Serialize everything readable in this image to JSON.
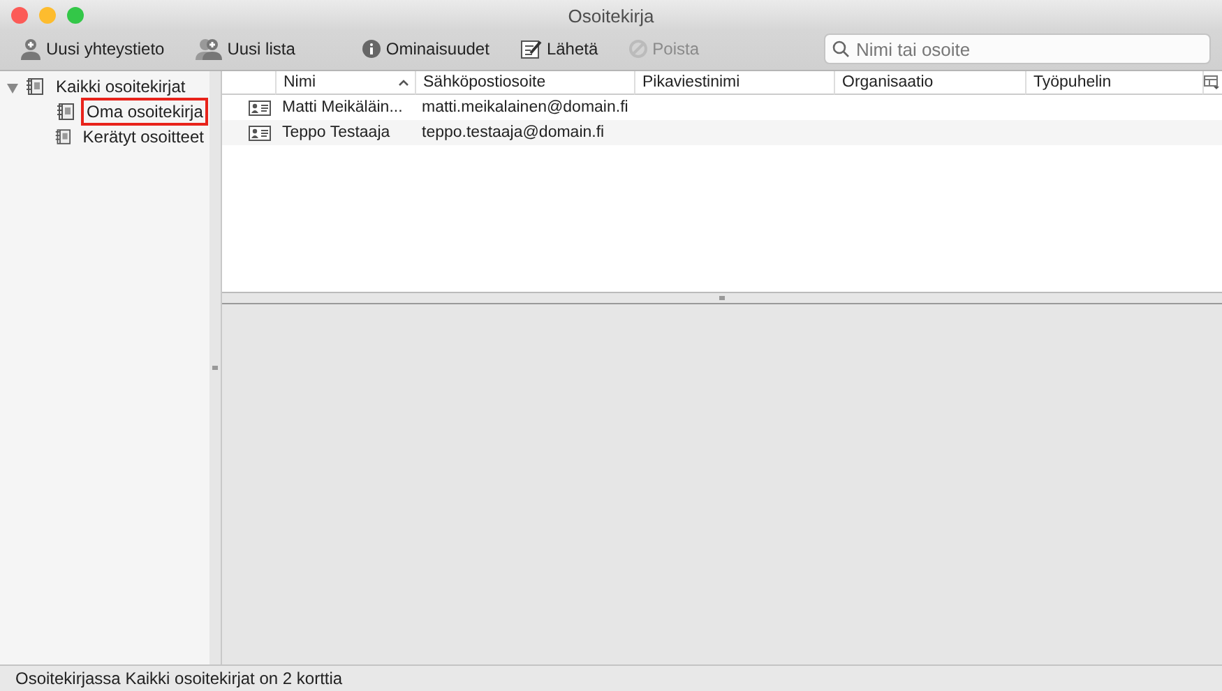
{
  "window": {
    "title": "Osoitekirja"
  },
  "toolbar": {
    "buttons": [
      {
        "label": "Uusi yhteystieto",
        "kind": "contact",
        "disabled": false
      },
      {
        "label": "Uusi lista",
        "kind": "list",
        "disabled": false
      },
      {
        "label": "Ominaisuudet",
        "kind": "info",
        "disabled": false
      },
      {
        "label": "Lähetä",
        "kind": "compose",
        "disabled": false
      },
      {
        "label": "Poista",
        "kind": "delete",
        "disabled": true
      }
    ],
    "search": {
      "placeholder": "Nimi tai osoite"
    }
  },
  "sidebar": {
    "items": [
      {
        "label": "Kaikki osoitekirjat",
        "expanded": true,
        "highlighted": false,
        "children": [
          {
            "label": "Oma osoitekirja",
            "highlighted": true
          },
          {
            "label": "Kerätyt osoitteet",
            "highlighted": false
          }
        ]
      }
    ]
  },
  "table": {
    "columns": [
      {
        "label": "Nimi",
        "sorted": true
      },
      {
        "label": "Sähköpostiosoite",
        "sorted": false
      },
      {
        "label": "Pikaviestinimi",
        "sorted": false
      },
      {
        "label": "Organisaatio",
        "sorted": false
      },
      {
        "label": "Työpuhelin",
        "sorted": false
      }
    ],
    "rows": [
      {
        "cells": [
          "Matti Meikäläin...",
          "matti.meikalainen@domain.fi",
          "",
          "",
          ""
        ]
      },
      {
        "cells": [
          "Teppo Testaaja",
          "teppo.testaaja@domain.fi",
          "",
          "",
          ""
        ]
      }
    ]
  },
  "status_bar": "Osoitekirjassa Kaikki osoitekirjat on 2 korttia"
}
